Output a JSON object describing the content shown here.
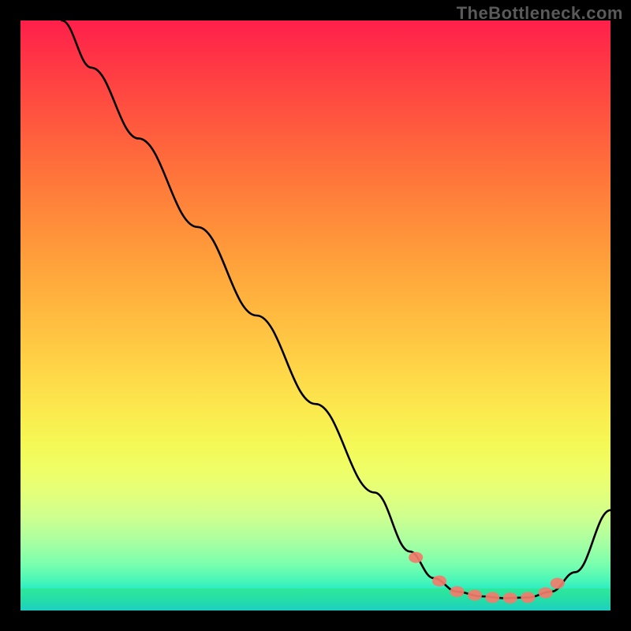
{
  "attribution": "TheBottleneck.com",
  "chart_data": {
    "type": "line",
    "title": "",
    "xlabel": "",
    "ylabel": "",
    "xlim": [
      0,
      100
    ],
    "ylim": [
      0,
      100
    ],
    "series": [
      {
        "name": "bottleneck-curve",
        "x": [
          7,
          12,
          20,
          30,
          40,
          50,
          60,
          66,
          70,
          74,
          78,
          82,
          86,
          90,
          94,
          100
        ],
        "y": [
          100,
          92,
          80,
          65,
          50,
          35,
          20,
          10,
          5.5,
          3.2,
          2.4,
          2.1,
          2.2,
          3.2,
          6.5,
          17
        ]
      }
    ],
    "markers": {
      "name": "optimal-range-dots",
      "x": [
        67,
        71,
        74,
        77,
        80,
        83,
        86,
        89,
        91
      ],
      "y": [
        9.0,
        5.0,
        3.2,
        2.6,
        2.2,
        2.1,
        2.2,
        3.0,
        4.6
      ]
    }
  }
}
